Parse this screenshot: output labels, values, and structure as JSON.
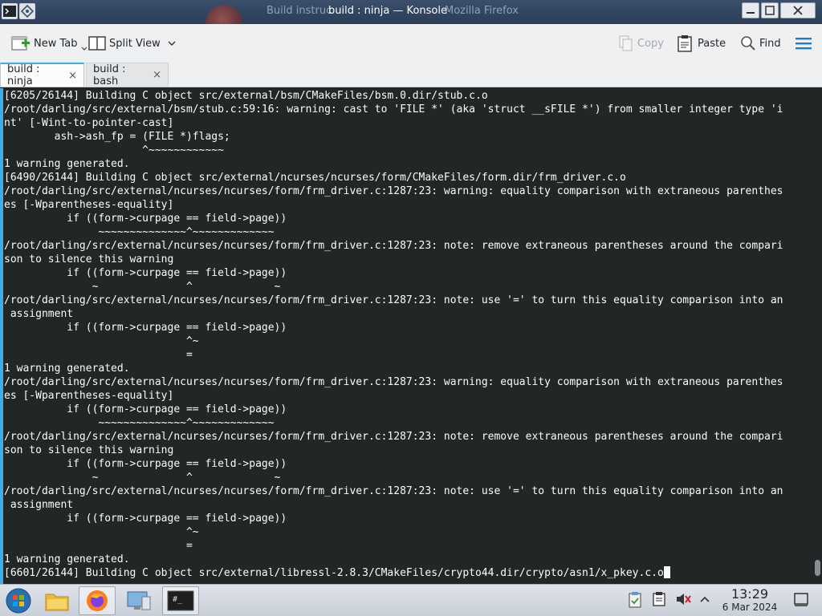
{
  "window": {
    "title": "build : ninja — Konsole",
    "ghost_left": "Build instruc",
    "ghost_right": "Mozilla Firefox"
  },
  "toolbar": {
    "new_tab": "New Tab",
    "split_view": "Split View",
    "copy": "Copy",
    "paste": "Paste",
    "find": "Find"
  },
  "tabs": [
    {
      "label": "build : ninja",
      "close": "×"
    },
    {
      "label": "build : bash",
      "close": "×"
    }
  ],
  "terminal": {
    "lines": [
      "[6205/26144] Building C object src/external/bsm/CMakeFiles/bsm.0.dir/stub.c.o",
      "/root/darling/src/external/bsm/stub.c:59:16: warning: cast to 'FILE *' (aka 'struct __sFILE *') from smaller integer type 'i",
      "nt' [-Wint-to-pointer-cast]",
      "        ash->ash_fp = (FILE *)flags;",
      "                      ^~~~~~~~~~~~~",
      "1 warning generated.",
      "[6490/26144] Building C object src/external/ncurses/ncurses/form/CMakeFiles/form.dir/frm_driver.c.o",
      "/root/darling/src/external/ncurses/ncurses/form/frm_driver.c:1287:23: warning: equality comparison with extraneous parenthes",
      "es [-Wparentheses-equality]",
      "          if ((form->curpage == field->page))",
      "               ~~~~~~~~~~~~~~^~~~~~~~~~~~~~",
      "/root/darling/src/external/ncurses/ncurses/form/frm_driver.c:1287:23: note: remove extraneous parentheses around the compari",
      "son to silence this warning",
      "          if ((form->curpage == field->page))",
      "              ~              ^             ~",
      "/root/darling/src/external/ncurses/ncurses/form/frm_driver.c:1287:23: note: use '=' to turn this equality comparison into an",
      " assignment",
      "          if ((form->curpage == field->page))",
      "                             ^~",
      "                             =",
      "1 warning generated.",
      "/root/darling/src/external/ncurses/ncurses/form/frm_driver.c:1287:23: warning: equality comparison with extraneous parenthes",
      "es [-Wparentheses-equality]",
      "          if ((form->curpage == field->page))",
      "               ~~~~~~~~~~~~~~^~~~~~~~~~~~~~",
      "/root/darling/src/external/ncurses/ncurses/form/frm_driver.c:1287:23: note: remove extraneous parentheses around the compari",
      "son to silence this warning",
      "          if ((form->curpage == field->page))",
      "              ~              ^             ~",
      "/root/darling/src/external/ncurses/ncurses/form/frm_driver.c:1287:23: note: use '=' to turn this equality comparison into an",
      " assignment",
      "          if ((form->curpage == field->page))",
      "                             ^~",
      "                             =",
      "1 warning generated.",
      "[6601/26144] Building C object src/external/libressl-2.8.3/CMakeFiles/crypto44.dir/crypto/asn1/x_pkey.c.o"
    ]
  },
  "taskbar": {
    "time": "13:29",
    "date": "6 Mar 2024",
    "konsole_icon_text": "#_"
  },
  "colors": {
    "terminal_bg": "#232627",
    "terminal_fg": "#fcfcfc",
    "accent": "#3daee9",
    "titlebar": "#2b3d57"
  }
}
